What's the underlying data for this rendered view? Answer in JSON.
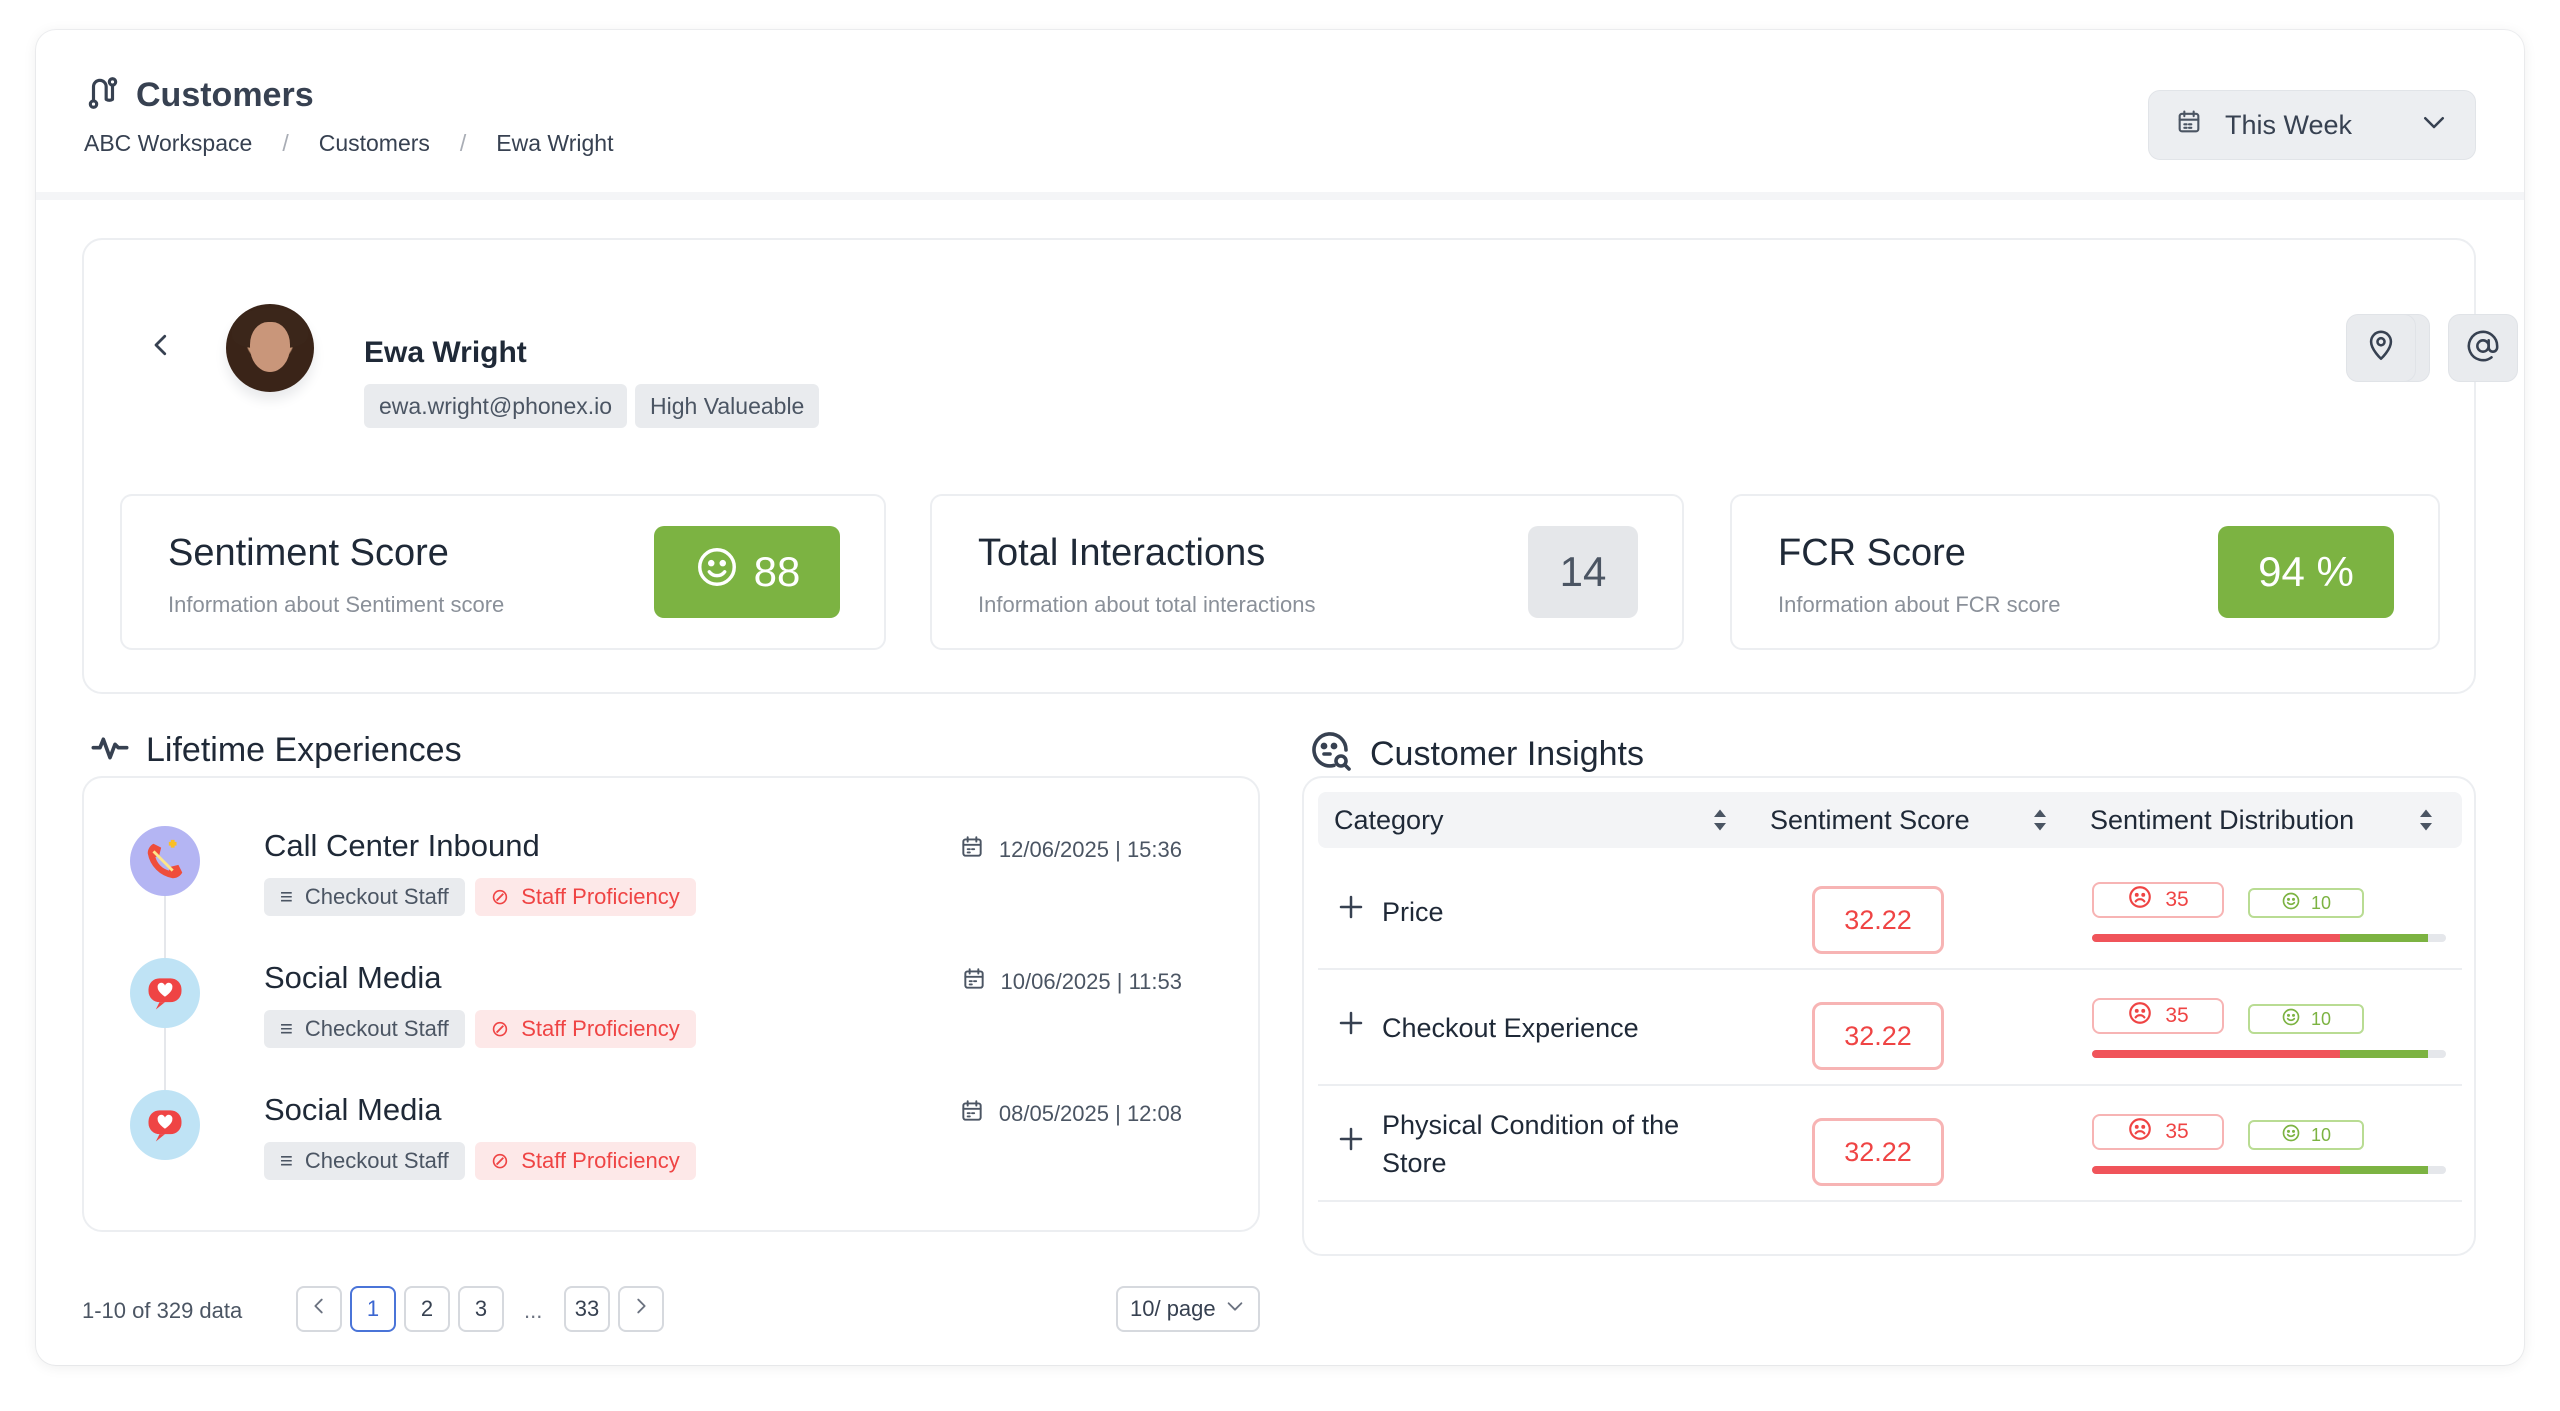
{
  "header": {
    "title": "Customers",
    "breadcrumb": [
      "ABC Workspace",
      "Customers",
      "Ewa Wright"
    ],
    "period": "This Week"
  },
  "profile": {
    "name": "Ewa Wright",
    "email": "ewa.wright@phonex.io",
    "segment": "High Valueable"
  },
  "metrics": [
    {
      "title": "Sentiment Score",
      "desc": "Information about Sentiment score",
      "value": "88"
    },
    {
      "title": "Total Interactions",
      "desc": "Information about total interactions",
      "value": "14"
    },
    {
      "title": "FCR Score",
      "desc": "Information about FCR score",
      "value": "94 %"
    }
  ],
  "lifetime": {
    "title": "Lifetime Experiences",
    "items": [
      {
        "title": "Call Center Inbound",
        "date": "12/06/2025 | 15:36",
        "tags": [
          "Checkout Staff",
          "Staff Proficiency"
        ],
        "icon": "phone-call-icon"
      },
      {
        "title": "Social Media",
        "date": "10/06/2025 | 11:53",
        "tags": [
          "Checkout Staff",
          "Staff Proficiency"
        ],
        "icon": "social-heart-icon"
      },
      {
        "title": "Social Media",
        "date": "08/05/2025 | 12:08",
        "tags": [
          "Checkout Staff",
          "Staff Proficiency"
        ],
        "icon": "social-heart-icon"
      }
    ],
    "pagination": {
      "summary": "1-10 of 329 data",
      "pages": [
        "1",
        "2",
        "3"
      ],
      "ellipsis": "...",
      "last": "33",
      "active": "1",
      "per_page": "10/ page"
    }
  },
  "insights": {
    "title": "Customer Insights",
    "columns": [
      "Category",
      "Sentiment Score",
      "Sentiment Distribution"
    ],
    "rows": [
      {
        "category": "Price",
        "score": "32.22",
        "negative": "35",
        "positive": "10",
        "neg_share": 0.7,
        "pos_share": 0.25
      },
      {
        "category": "Checkout Experience",
        "score": "32.22",
        "negative": "35",
        "positive": "10",
        "neg_share": 0.7,
        "pos_share": 0.25
      },
      {
        "category": "Physical Condition of the Store",
        "score": "32.22",
        "negative": "35",
        "positive": "10",
        "neg_share": 0.7,
        "pos_share": 0.25
      }
    ]
  },
  "colors": {
    "positive": "#7cb342",
    "negative": "#ef4444",
    "active_page": "#3b66d1"
  }
}
